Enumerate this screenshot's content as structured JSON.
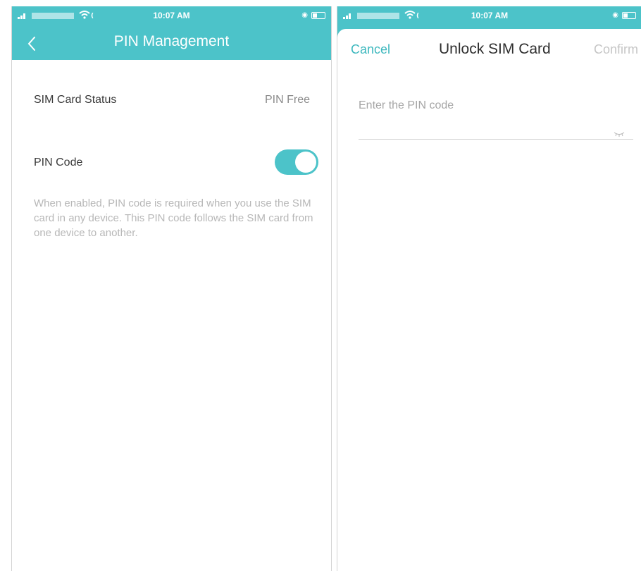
{
  "caption": "",
  "status_bar": {
    "time": "10:07 AM"
  },
  "left_screen": {
    "title": "PIN Management",
    "rows": [
      {
        "label": "SIM Card Status",
        "value": "PIN Free"
      },
      {
        "label": "PIN Code",
        "toggle_on": true
      }
    ],
    "description": "When enabled, PIN code is required when you use the SIM card in any device. This PIN code follows the SIM card from one device to another."
  },
  "right_screen": {
    "cancel_label": "Cancel",
    "title": "Unlock SIM Card",
    "confirm_label": "Confirm",
    "pin_input": {
      "placeholder": "Enter the PIN code",
      "value": ""
    }
  },
  "colors": {
    "accent": "#4cc3c9",
    "accent_text": "#3db8be",
    "background": "#ffffff"
  },
  "icons": [
    "signal-icon",
    "wifi-icon",
    "battery-icon",
    "back-chevron-icon",
    "eye-closed-icon"
  ]
}
